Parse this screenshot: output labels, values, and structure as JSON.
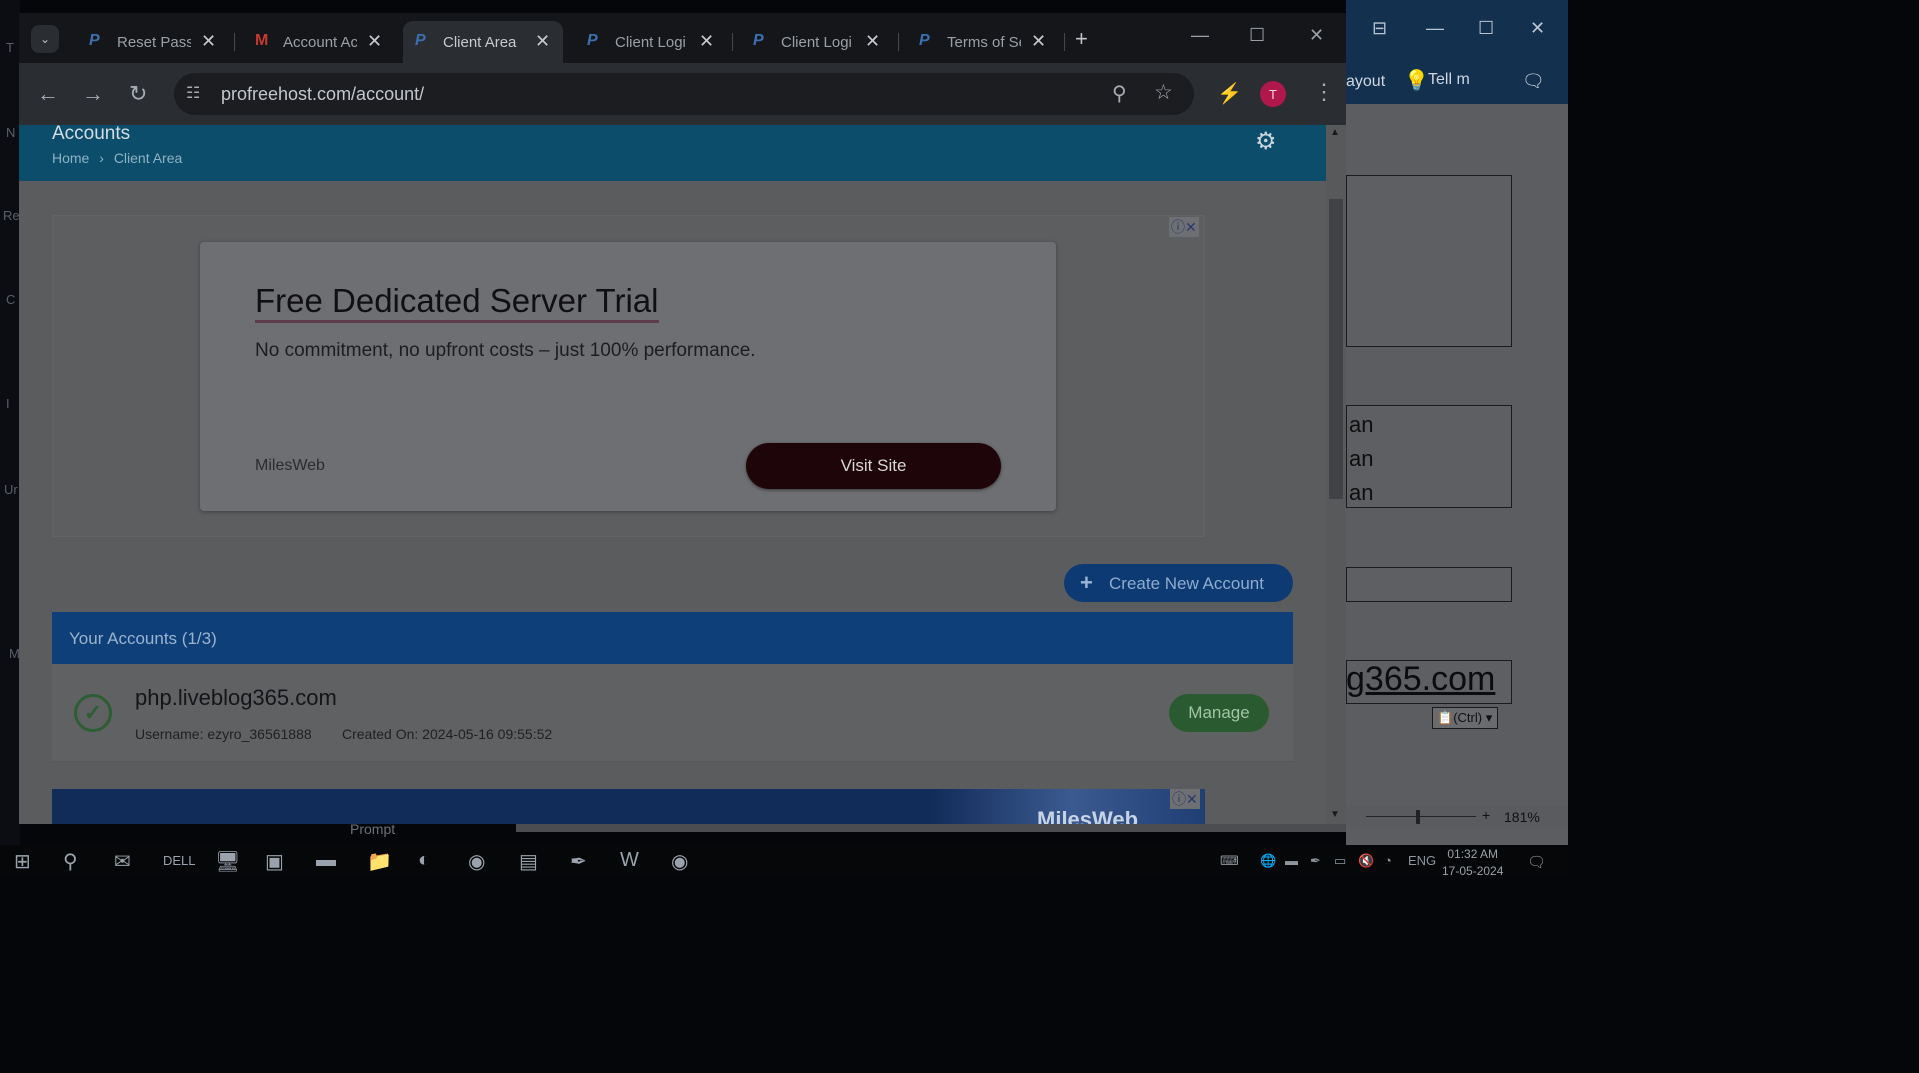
{
  "desktop_left": {
    "letters": [
      "T",
      "N",
      "Re",
      "C",
      "I",
      "Ur",
      "M"
    ]
  },
  "word": {
    "ribbon_layout": "ayout",
    "tell_me": "Tell m",
    "rows": [
      "an",
      "an",
      "an"
    ],
    "link_text": "g365.com",
    "paste_label": "(Ctrl)",
    "zoom": "181%"
  },
  "browser": {
    "tabs": [
      {
        "title": "Reset Passw",
        "favicon": "profreehost-icon",
        "active": false
      },
      {
        "title": "Account Ac",
        "favicon": "gmail-icon",
        "active": false
      },
      {
        "title": "Client Area",
        "favicon": "profreehost-icon",
        "active": true
      },
      {
        "title": "Client Logi",
        "favicon": "profreehost-icon",
        "active": false
      },
      {
        "title": "Client Logi",
        "favicon": "profreehost-icon",
        "active": false
      },
      {
        "title": "Terms of Se",
        "favicon": "profreehost-icon",
        "active": false
      }
    ],
    "url": "profreehost.com/account/",
    "profile_initial": "T"
  },
  "page": {
    "heading": "Accounts",
    "breadcrumb": {
      "home": "Home",
      "separator": "›",
      "current": "Client Area"
    },
    "ad": {
      "title": "Free Dedicated Server Trial",
      "subtitle": "No commitment, no upfront costs – just 100% performance.",
      "brand": "MilesWeb",
      "cta": "Visit Site"
    },
    "create_button": "Create New Account",
    "accounts_header": "Your Accounts (1/3)",
    "accounts": [
      {
        "domain": "php.liveblog365.com",
        "username_label": "Username:",
        "username": "ezyro_36561888",
        "created_label": "Created On:",
        "created": "2024-05-16 09:55:52",
        "action": "Manage"
      }
    ],
    "banner_logo": "MilesWeb"
  },
  "behind_text": "Prompt",
  "taskbar": {
    "language": "ENG",
    "time": "01:32 AM",
    "date": "17-05-2024"
  },
  "colors": {
    "page_header": "#0b4d6b",
    "accounts_header": "#0e3f78",
    "manage_button": "#2a5a2f",
    "visit_button": "#1e0509"
  }
}
